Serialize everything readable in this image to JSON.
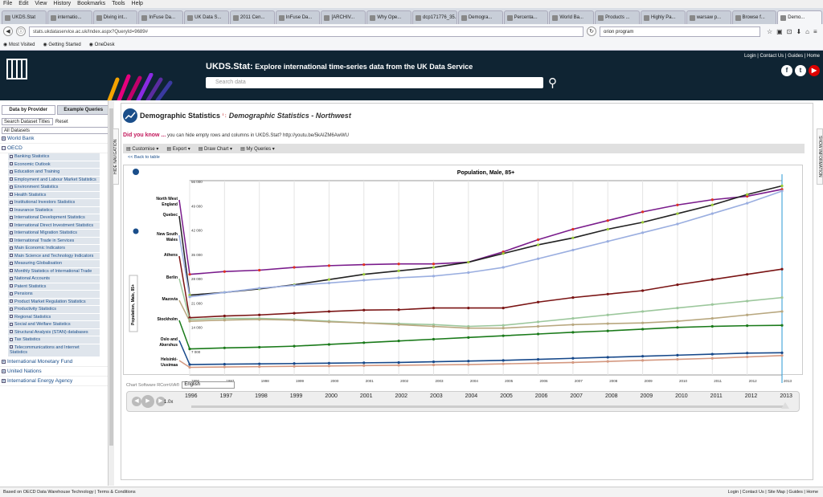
{
  "browser": {
    "menu": [
      "File",
      "Edit",
      "View",
      "History",
      "Bookmarks",
      "Tools",
      "Help"
    ],
    "tabs": [
      {
        "label": "UKDS.Stat"
      },
      {
        "label": "internatio..."
      },
      {
        "label": "Diving int..."
      },
      {
        "label": "InFuse Da..."
      },
      {
        "label": "UK Data S..."
      },
      {
        "label": "2011 Cen..."
      },
      {
        "label": "InFuse Da..."
      },
      {
        "label": "[ARCHIV..."
      },
      {
        "label": "Why Ope..."
      },
      {
        "label": "dcp171776_35..."
      },
      {
        "label": "Demogra..."
      },
      {
        "label": "Percenta..."
      },
      {
        "label": "World Ba..."
      },
      {
        "label": "Products ..."
      },
      {
        "label": "Highly Pa..."
      },
      {
        "label": "warsaw p..."
      },
      {
        "label": "Browse f..."
      },
      {
        "label": "Demo..."
      }
    ],
    "url": "stats.ukdataservice.ac.uk/Index.aspx?QueryId=9689#",
    "search_value": "orion program",
    "bookmarks": [
      "Most Visited",
      "Getting Started",
      "OneDesk"
    ]
  },
  "header": {
    "brand": "UKDS.Stat:",
    "tagline": "Explore international time-series data from the UK Data Service",
    "search_placeholder": "Search data",
    "links": "Login | Contact Us | Guides | Home",
    "social": [
      "f",
      "t",
      "▶"
    ]
  },
  "sidebar": {
    "tab_provider": "Data by Provider",
    "tab_examples": "Example Queries",
    "search_label": "Search Dataset Titles",
    "reset": "Reset",
    "select": "All Datasets",
    "providers_top": [
      "World Bank",
      "OECD"
    ],
    "oecd_items": [
      "Banking Statistics",
      "Economic Outlook",
      "Education and Training",
      "Employment and Labour Market Statistics",
      "Environment Statistics",
      "Health Statistics",
      "Institutional Investors Statistics",
      "Insurance Statistics",
      "International Development Statistics",
      "International Direct Investment Statistics",
      "International Migration Statistics",
      "International Trade in Services",
      "Main Economic Indicators",
      "Main Science and Technology Indicators",
      "Measuring Globalisation",
      "Monthly Statistics of International Trade",
      "National Accounts",
      "Patent Statistics",
      "Pensions",
      "Product Market Regulation Statistics",
      "Productivity Statistics",
      "Regional Statistics",
      "Social and Welfare Statistics",
      "Structural Analysis (STAN) databases",
      "Tax Statistics",
      "Telecommunications and Internet Statistics"
    ],
    "providers_bottom": [
      "International Monetary Fund",
      "United Nations",
      "International Energy Agency"
    ]
  },
  "main": {
    "title": "Demographic Statistics",
    "subtitle": "Demographic Statistics - Northwest",
    "did_you_know": "Did you know ...",
    "tip": "you can hide empty rows and columns in UKDS.Stat? http://youtu.be/5kAIZM6AwWU",
    "toolbar": [
      "Customise",
      "Export",
      "Draw Chart",
      "My Queries"
    ],
    "back": "<< Back to table",
    "hide_nav": "HIDE NAVIGATION",
    "show_info": "SHOW INFORMATION"
  },
  "chart_data": {
    "type": "line",
    "title": "Population, Male, 85+",
    "ylabel": "Population, Male, 85+",
    "x": [
      1996,
      1997,
      1998,
      1999,
      2000,
      2001,
      2002,
      2003,
      2004,
      2005,
      2006,
      2007,
      2008,
      2009,
      2010,
      2011,
      2012,
      2013
    ],
    "ylim": [
      0,
      56000
    ],
    "yticks": [
      7000,
      14000,
      21000,
      28000,
      35000,
      42000,
      49000,
      56000
    ],
    "category_labels": [
      "North West England",
      "Quebec",
      "New South Wales",
      "Athens",
      "Berlin",
      "Mazovia",
      "Stockholm",
      "Oslo and Akershus",
      "Helsinki-Uusimaa"
    ],
    "series": [
      {
        "name": "North West England",
        "color": "#7a1c8c",
        "values": [
          29000,
          29800,
          30200,
          31000,
          31500,
          31800,
          32000,
          32000,
          32500,
          35500,
          39000,
          42000,
          44500,
          47000,
          49000,
          50500,
          51500,
          53500
        ]
      },
      {
        "name": "Quebec",
        "color": "#222222",
        "values": [
          23000,
          23800,
          24800,
          26000,
          27500,
          29000,
          30000,
          31000,
          32500,
          35000,
          37500,
          39500,
          42000,
          44000,
          46500,
          49000,
          52000,
          54500
        ]
      },
      {
        "name": "New South Wales",
        "color": "#9aaee0",
        "values": [
          22500,
          23800,
          25000,
          25800,
          26500,
          27300,
          28000,
          28500,
          29500,
          31000,
          33500,
          36000,
          38500,
          41000,
          43500,
          46500,
          49500,
          53000
        ]
      },
      {
        "name": "Athens",
        "color": "#7a1414",
        "values": [
          16500,
          17000,
          17300,
          17800,
          18300,
          18700,
          18800,
          19300,
          19300,
          19300,
          21000,
          22300,
          23300,
          24300,
          26000,
          27500,
          29000,
          30500
        ]
      },
      {
        "name": "Berlin",
        "color": "#9cc79c",
        "values": [
          16000,
          16300,
          16300,
          16000,
          15500,
          15000,
          14800,
          14500,
          14000,
          14300,
          15300,
          16300,
          17300,
          18300,
          19300,
          20300,
          21300,
          22300
        ]
      },
      {
        "name": "Mazovia",
        "color": "#b8a77f",
        "values": [
          15500,
          15800,
          16000,
          15800,
          15300,
          15000,
          14500,
          14000,
          13500,
          13500,
          14000,
          14500,
          14800,
          15000,
          15500,
          16300,
          17300,
          18300
        ]
      },
      {
        "name": "Stockholm",
        "color": "#1a7a1a",
        "values": [
          7500,
          7800,
          8000,
          8300,
          8800,
          9300,
          9800,
          10300,
          10800,
          11300,
          11800,
          12300,
          12700,
          13200,
          13700,
          14000,
          14200,
          14300
        ]
      },
      {
        "name": "Oslo and Akershus",
        "color": "#16488a",
        "values": [
          3000,
          3100,
          3200,
          3300,
          3400,
          3500,
          3600,
          3800,
          4000,
          4200,
          4500,
          4800,
          5100,
          5400,
          5700,
          6000,
          6300,
          6400
        ]
      },
      {
        "name": "Helsinki-Uusimaa",
        "color": "#d49880",
        "values": [
          2200,
          2300,
          2400,
          2500,
          2600,
          2700,
          2800,
          2900,
          3000,
          3200,
          3400,
          3600,
          3900,
          4200,
          4500,
          4800,
          5200,
          5600
        ]
      }
    ]
  },
  "controls": {
    "language_label": "Chart Software RComViA®",
    "language": "English",
    "speed": "1.0x",
    "years": [
      "1996",
      "1997",
      "1998",
      "1999",
      "2000",
      "2001",
      "2002",
      "2003",
      "2004",
      "2005",
      "2006",
      "2007",
      "2008",
      "2009",
      "2010",
      "2011",
      "2012",
      "2013"
    ]
  },
  "statusbar": {
    "left": "Based on OECD Data Warehouse Technology | Terms & Conditions",
    "right": "Login | Contact Us | Site Map | Guides | Home"
  }
}
